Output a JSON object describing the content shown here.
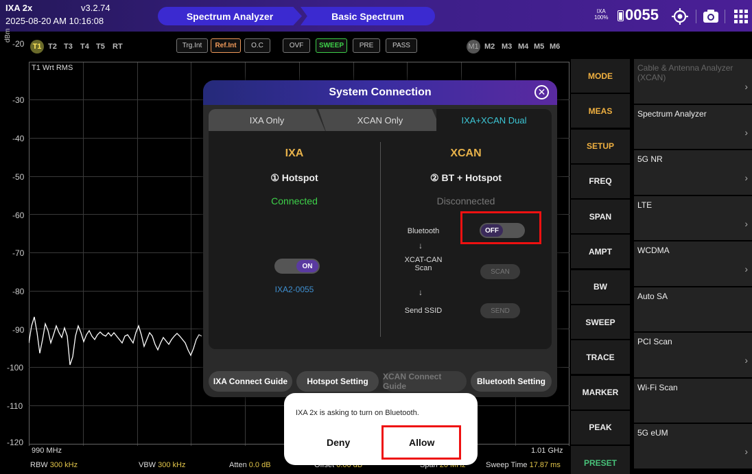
{
  "device": {
    "name": "IXA 2x",
    "version": "v3.2.74",
    "datetime": "2025-08-20 AM 10:16:08",
    "battery_badge": "IXA\n100%",
    "serial": "0055"
  },
  "breadcrumb": [
    "Spectrum Analyzer",
    "Basic Spectrum"
  ],
  "header_icons": [
    "gps-icon",
    "camera-icon",
    "grid-menu-icon"
  ],
  "traces": [
    "T1",
    "T2",
    "T3",
    "T4",
    "T5",
    "RT"
  ],
  "tags": [
    "Trg.Int",
    "Ref.Int",
    "O.C",
    "OVF",
    "SWEEP",
    "PRE",
    "PASS"
  ],
  "markers": [
    "M1",
    "M2",
    "M3",
    "M4",
    "M5",
    "M6"
  ],
  "plot": {
    "unit": "dBm",
    "trace_label": "T1 Wrt RMS",
    "y_ticks": [
      "-20",
      "-30",
      "-40",
      "-50",
      "-60",
      "-70",
      "-80",
      "-90",
      "-100",
      "-110",
      "-120"
    ],
    "start_freq": "990 MHz",
    "stop_freq": "1.01 GHz"
  },
  "footer": {
    "rbw_label": "RBW",
    "rbw": "300 kHz",
    "vbw_label": "VBW",
    "vbw": "300 kHz",
    "atten_label": "Atten",
    "atten": "0.0 dB",
    "offset_label": "Offset",
    "offset": "0.00 dB",
    "span_label": "Span",
    "span": "20 MHz",
    "sweep_label": "Sweep Time",
    "sweep": "17.87 ms"
  },
  "keys": [
    "MODE",
    "MEAS",
    "SETUP",
    "FREQ",
    "SPAN",
    "AMPT",
    "BW",
    "SWEEP",
    "TRACE",
    "MARKER",
    "PEAK",
    "PRESET"
  ],
  "menu": [
    "Cable & Antenna Analyzer (XCAN)",
    "Spectrum Analyzer",
    "5G NR",
    "LTE",
    "WCDMA",
    "Auto SA",
    "PCI Scan",
    "Wi-Fi Scan",
    "5G eUM"
  ],
  "dialog": {
    "title": "System Connection",
    "tabs": [
      "IXA Only",
      "XCAN Only",
      "IXA+XCAN Dual"
    ],
    "ixa": {
      "title": "IXA",
      "step": "① Hotspot",
      "status": "Connected",
      "toggle": "ON",
      "ssid": "IXA2-0055"
    },
    "xcan": {
      "title": "XCAN",
      "step": "② BT + Hotspot",
      "status": "Disconnected",
      "bluetooth_label": "Bluetooth",
      "bluetooth_toggle": "OFF",
      "scan_label": "XCAT-CAN Scan",
      "scan_button": "SCAN",
      "ssid_label": "Send SSID",
      "send_button": "SEND",
      "arrow": "↓"
    },
    "buttons": [
      "IXA Connect Guide",
      "Hotspot Setting",
      "XCAN Connect Guide",
      "Bluetooth Setting"
    ]
  },
  "permission": {
    "message": "IXA 2x is asking to turn on Bluetooth.",
    "deny": "Deny",
    "allow": "Allow"
  },
  "colors": {
    "accent": "#3b2ad0",
    "highlight": "#e11111",
    "connected": "#3ed14a",
    "label_yellow": "#e3c64a"
  }
}
